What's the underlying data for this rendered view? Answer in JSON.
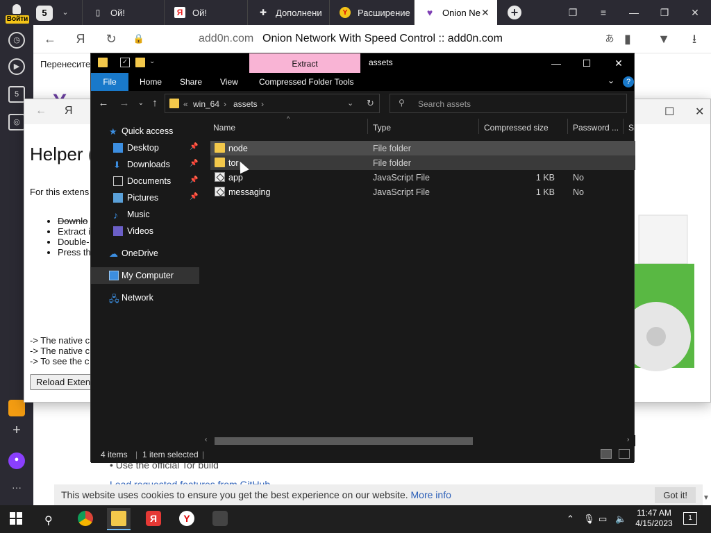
{
  "browser": {
    "side_login": "Войти",
    "tab_count": "5",
    "tabs": [
      {
        "label": "Ой!",
        "icon": "document-icon"
      },
      {
        "label": "Ой!",
        "icon": "yandex-icon"
      },
      {
        "label": "Дополнени",
        "icon": "puzzle-icon"
      },
      {
        "label": "Расширение",
        "icon": "yandex-browser-icon"
      },
      {
        "label": "Onion Ne",
        "icon": "onion-icon"
      }
    ],
    "url": "add0n.com",
    "page_title": "Onion Network With Speed Control :: add0n.com",
    "bookmark_text": "Перенесите",
    "left_badge": "5"
  },
  "helper": {
    "title": "Helper (",
    "intro": "For this extens",
    "steps": [
      "Downlo",
      "Extract i",
      "Double-",
      "Press th"
    ],
    "notes": [
      "-> The native c",
      "-> The native c",
      "-> To see the c"
    ],
    "reload_label": "Reload Exten"
  },
  "page": {
    "bullet_text": "Use the official Tor build",
    "link_text": "Load requested features from GitHub",
    "cookie_text": "This website uses cookies to ensure you get the best experience on our website.",
    "cookie_more": "More info",
    "cookie_ok": "Got it!"
  },
  "explorer": {
    "extract_tab": "Extract",
    "title": "assets",
    "ribbon_tabs": [
      "File",
      "Home",
      "Share",
      "View",
      "Compressed Folder Tools"
    ],
    "breadcrumb": [
      "win_64",
      "assets"
    ],
    "search_placeholder": "Search assets",
    "nav_pane": [
      {
        "label": "Quick access",
        "icon": "star-icon",
        "pinned": false
      },
      {
        "label": "Desktop",
        "icon": "desktop-folder-icon",
        "pinned": true
      },
      {
        "label": "Downloads",
        "icon": "downloads-folder-icon",
        "pinned": true
      },
      {
        "label": "Documents",
        "icon": "documents-folder-icon",
        "pinned": true
      },
      {
        "label": "Pictures",
        "icon": "pictures-folder-icon",
        "pinned": true
      },
      {
        "label": "Music",
        "icon": "music-icon",
        "pinned": false
      },
      {
        "label": "Videos",
        "icon": "videos-icon",
        "pinned": false
      },
      {
        "label": "OneDrive",
        "icon": "cloud-icon",
        "pinned": false
      },
      {
        "label": "My Computer",
        "icon": "computer-icon",
        "pinned": false
      },
      {
        "label": "Network",
        "icon": "network-icon",
        "pinned": false
      }
    ],
    "columns": [
      "Name",
      "Type",
      "Compressed size",
      "Password ...",
      "Si"
    ],
    "files": [
      {
        "name": "node",
        "type": "File folder",
        "size": "",
        "password": "",
        "icon": "folder-icon"
      },
      {
        "name": "tor",
        "type": "File folder",
        "size": "",
        "password": "",
        "icon": "folder-icon"
      },
      {
        "name": "app",
        "type": "JavaScript File",
        "size": "1 KB",
        "password": "No",
        "icon": "script-file-icon"
      },
      {
        "name": "messaging",
        "type": "JavaScript File",
        "size": "1 KB",
        "password": "No",
        "icon": "script-file-icon"
      }
    ],
    "status": {
      "items": "4 items",
      "selected": "1 item selected"
    }
  },
  "taskbar": {
    "apps": [
      "chrome-icon",
      "file-explorer-icon",
      "yandex-icon",
      "yandex-browser-icon",
      "tor-icon"
    ],
    "time": "11:47 AM",
    "date": "4/15/2023",
    "notifications": "1"
  },
  "colors": {
    "explorer_bg": "#191919",
    "file_tab": "#1979ca",
    "extract_tab": "#f9b4d5",
    "folder": "#f3c84b"
  }
}
